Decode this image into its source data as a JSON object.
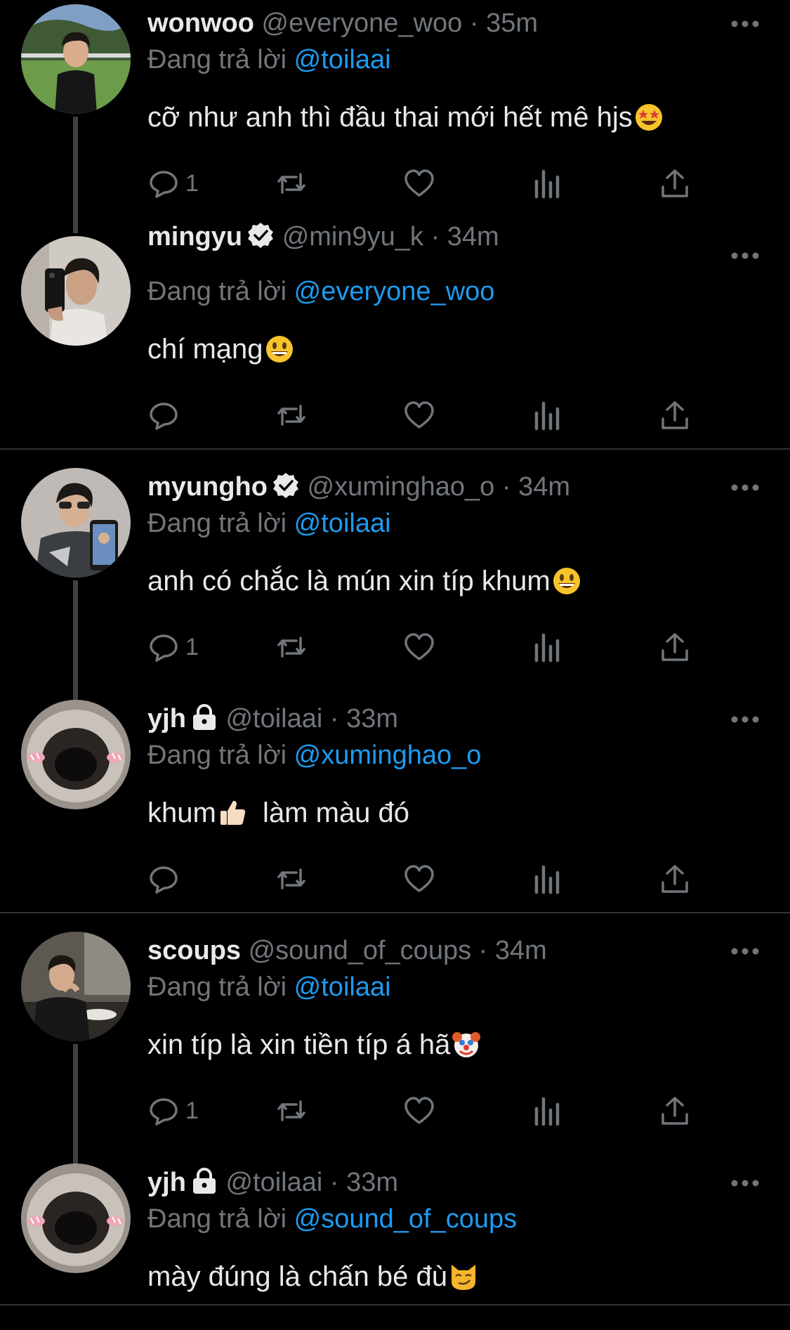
{
  "tweets": [
    {
      "name": "wonwoo",
      "verified": false,
      "locked": false,
      "handle": "@everyone_woo",
      "time": "35m",
      "reply_prefix": "Đang trả lời",
      "reply_to": "@toilaai",
      "text": "cỡ như anh thì đầu thai mới hết mê hjs",
      "emoji": "star-struck-face",
      "reply_count": "1",
      "avatar": "photo-man-outdoor"
    },
    {
      "name": "mingyu",
      "verified": true,
      "locked": false,
      "handle": "@min9yu_k",
      "time": "34m",
      "reply_prefix": "Đang trả lời",
      "reply_to": "@everyone_woo",
      "text": "chí mạng",
      "emoji": "grinning-face",
      "reply_count": "",
      "avatar": "photo-mirror-selfie"
    },
    {
      "name": "myungho",
      "verified": true,
      "locked": false,
      "handle": "@xuminghao_o",
      "time": "34m",
      "reply_prefix": "Đang trả lời",
      "reply_to": "@toilaai",
      "text": "anh có chắc là mún xin típ khum",
      "emoji": "grinning-face",
      "reply_count": "1",
      "avatar": "photo-sunglasses-selfie"
    },
    {
      "name": "yjh",
      "verified": false,
      "locked": true,
      "handle": "@toilaai",
      "time": "33m",
      "reply_prefix": "Đang trả lời",
      "reply_to": "@xuminghao_o",
      "text": "khum",
      "text_after": " làm màu đó",
      "emoji": "thumbs-up",
      "reply_count": "",
      "avatar": "seal-closeup"
    },
    {
      "name": "scoups",
      "verified": false,
      "locked": false,
      "handle": "@sound_of_coups",
      "time": "34m",
      "reply_prefix": "Đang trả lời",
      "reply_to": "@toilaai",
      "text": "xin típ là xin tiền típ á hã",
      "emoji": "clown-face",
      "reply_count": "1",
      "avatar": "photo-restaurant"
    },
    {
      "name": "yjh",
      "verified": false,
      "locked": true,
      "handle": "@toilaai",
      "time": "33m",
      "reply_prefix": "Đang trả lời",
      "reply_to": "@sound_of_coups",
      "text": "mày đúng là chấn bé đù",
      "emoji": "smirking-cat",
      "reply_count": "",
      "avatar": "seal-closeup"
    }
  ],
  "colors": {
    "background": "#000000",
    "text": "#e7e9ea",
    "muted": "#71767b",
    "link": "#1d9bf0",
    "divider": "#2f3336"
  },
  "icons": {
    "more": "more-dots-icon",
    "reply": "reply-icon",
    "retweet": "retweet-icon",
    "like": "heart-icon",
    "views": "views-icon",
    "share": "share-icon"
  }
}
